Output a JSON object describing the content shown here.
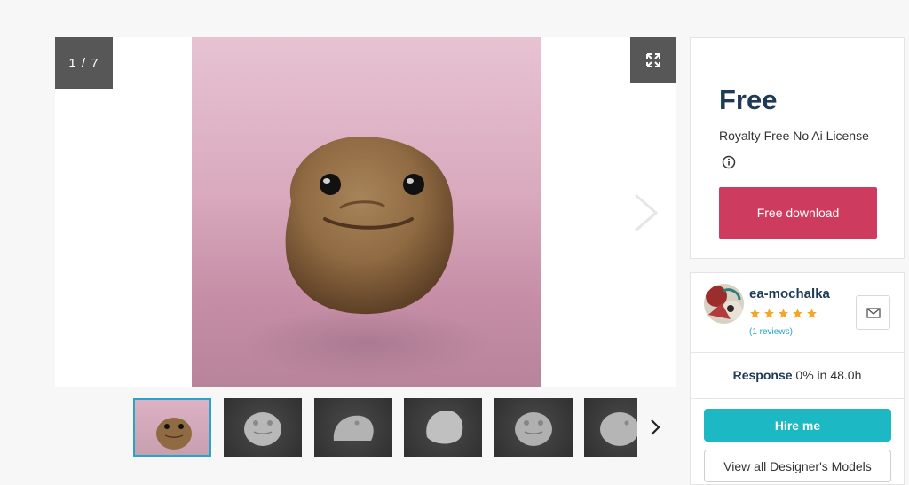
{
  "gallery": {
    "counter": "1 / 7",
    "thumbnail_count": 6
  },
  "pricing": {
    "price": "Free",
    "license": "Royalty Free No Ai License",
    "download_label": "Free download",
    "download_color": "#cd3b5e"
  },
  "designer": {
    "name": "ea-mochalka",
    "rating": 5,
    "reviews": "(1 reviews)",
    "response_label": "Response",
    "response_value": "0% in 48.0h",
    "hire_label": "Hire me",
    "hire_color": "#1cb8c4",
    "models_label": "View all Designer's Models"
  },
  "colors": {
    "star": "#f5a623",
    "accent_blue": "#29a4c8",
    "title_navy": "#1e3a56"
  },
  "icons": [
    "expand-icon",
    "chevron-right-icon",
    "info-icon",
    "mail-icon",
    "star-icon"
  ]
}
